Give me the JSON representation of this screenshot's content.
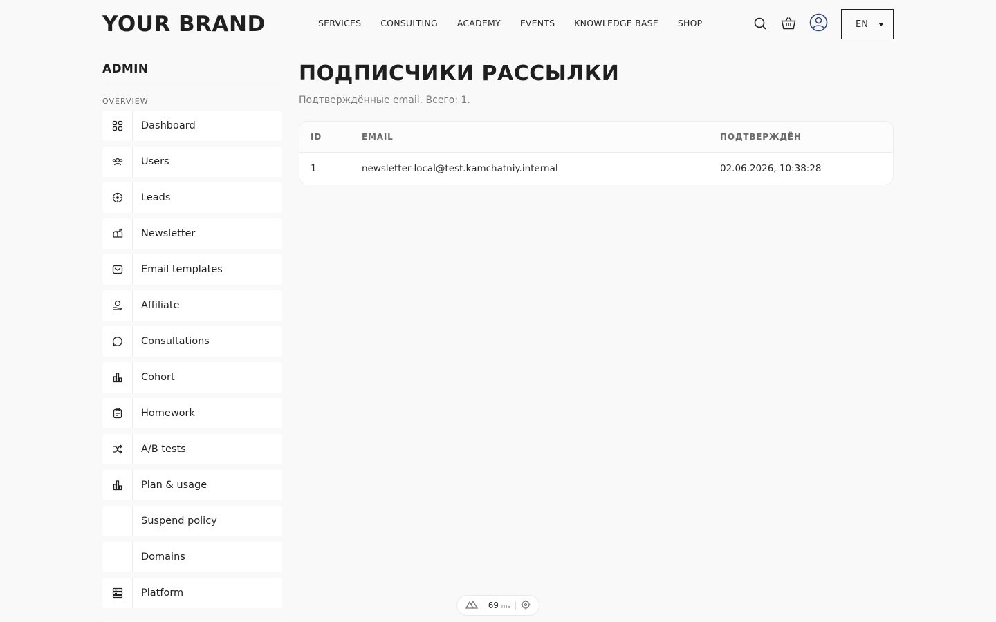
{
  "header": {
    "brand": "YOUR BRAND",
    "nav": [
      "SERVICES",
      "CONSULTING",
      "ACADEMY",
      "EVENTS",
      "KNOWLEDGE BASE",
      "SHOP"
    ],
    "language": "EN",
    "icons": [
      "search-icon",
      "cart-icon",
      "user-icon"
    ]
  },
  "sidebar": {
    "title": "ADMIN",
    "section": "OVERVIEW",
    "items": [
      {
        "label": "Dashboard",
        "icon": "grid-icon"
      },
      {
        "label": "Users",
        "icon": "users-icon"
      },
      {
        "label": "Leads",
        "icon": "target-icon"
      },
      {
        "label": "Newsletter",
        "icon": "mailbox-icon"
      },
      {
        "label": "Email templates",
        "icon": "envelope-icon"
      },
      {
        "label": "Affiliate",
        "icon": "hand-coin-icon"
      },
      {
        "label": "Consultations",
        "icon": "chat-icon"
      },
      {
        "label": "Cohort",
        "icon": "bar-chart-icon"
      },
      {
        "label": "Homework",
        "icon": "clipboard-icon"
      },
      {
        "label": "A/B tests",
        "icon": "shuffle-icon"
      },
      {
        "label": "Plan & usage",
        "icon": "bar-chart-icon"
      },
      {
        "label": "Suspend policy",
        "icon": ""
      },
      {
        "label": "Domains",
        "icon": ""
      },
      {
        "label": "Platform",
        "icon": "server-icon"
      }
    ]
  },
  "main": {
    "title": "ПОДПИСЧИКИ РАССЫЛКИ",
    "subtitle": "Подтверждённые email. Всего: 1.",
    "table": {
      "columns": [
        "ID",
        "EMAIL",
        "ПОДТВЕРЖДЁН"
      ],
      "rows": [
        [
          "1",
          "newsletter-local@test.kamchatniy.internal",
          "02.06.2026, 10:38:28"
        ]
      ]
    }
  },
  "devbar": {
    "value": "69",
    "unit": "ms"
  }
}
